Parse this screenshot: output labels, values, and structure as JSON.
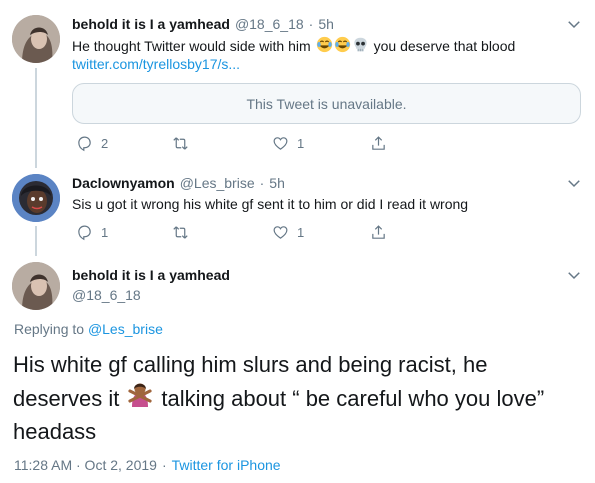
{
  "tweet1": {
    "display_name": "behold it is I a yamhead",
    "handle": "@18_6_18",
    "separator": "·",
    "time": "5h",
    "text_before": "He thought Twitter would side with him",
    "text_after": "you deserve that blood",
    "emojis": [
      "face-with-tears-of-joy",
      "face-with-tears-of-joy",
      "skull"
    ],
    "link": "twitter.com/tyrellosby17/s...",
    "card_text": "This Tweet is unavailable.",
    "reply_count": "2",
    "retweet_count": "",
    "like_count": "1"
  },
  "tweet2": {
    "display_name": "Daclownyamon",
    "handle": "@Les_brise",
    "separator": "·",
    "time": "5h",
    "text": "Sis u got it wrong his white gf sent it to him or did I read it wrong",
    "reply_count": "1",
    "retweet_count": "",
    "like_count": "1"
  },
  "main_tweet": {
    "display_name": "behold it is I a yamhead",
    "handle": "@18_6_18",
    "replying_label": "Replying to",
    "replying_handle": "@Les_brise",
    "line1": "His white gf calling him slurs and being racist, he",
    "line2_before": "deserves it",
    "line2_emoji": "person-gesturing-no",
    "line2_after": "talking about “ be careful who you love”",
    "line3": "headass",
    "timestamp": "11:28 AM · Oct 2, 2019",
    "separator": "·",
    "source": "Twitter for iPhone"
  },
  "colors": {
    "accent": "#1b95e0",
    "meta": "#657786",
    "border": "#ccd6dd",
    "card_bg": "#f5f8fa"
  },
  "icons": [
    "chevron-down-icon",
    "reply-icon",
    "retweet-icon",
    "like-icon",
    "share-icon"
  ]
}
